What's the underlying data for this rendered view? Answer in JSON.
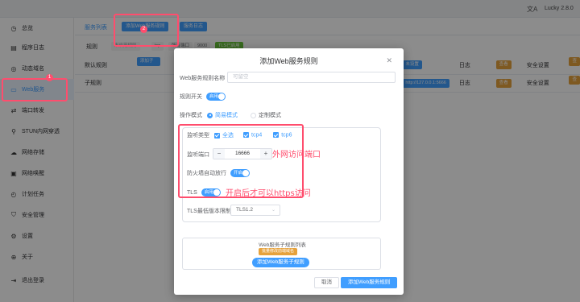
{
  "topbar": {
    "lang_icon": "文A",
    "version": "Lucky 2.8.0"
  },
  "sidebar": {
    "items": [
      {
        "label": "总览",
        "icon": "dashboard-icon"
      },
      {
        "label": "程序日志",
        "icon": "document-icon"
      },
      {
        "label": "动态域名",
        "icon": "globe-icon"
      },
      {
        "label": "Web服务",
        "icon": "web-icon"
      },
      {
        "label": "端口转发",
        "icon": "port-forward-icon"
      },
      {
        "label": "STUN内网穿透",
        "icon": "stun-icon"
      },
      {
        "label": "网络存储",
        "icon": "cloud-icon"
      },
      {
        "label": "网络唤醒",
        "icon": "wake-icon"
      },
      {
        "label": "计划任务",
        "icon": "clock-icon"
      },
      {
        "label": "安全管理",
        "icon": "shield-icon"
      },
      {
        "label": "设置",
        "icon": "gear-icon"
      },
      {
        "label": "关于",
        "icon": "info-icon"
      },
      {
        "label": "退出登录",
        "icon": "logout-icon"
      }
    ],
    "active_badge": "1"
  },
  "main": {
    "tab_label": "服务列表",
    "add_rule_btn": "添加Web服务规则",
    "log_btn": "服务日志",
    "add_badge": "2",
    "rule_label": "规则",
    "chips": [
      "未启用规则",
      "tcp",
      "所有端口",
      "9000",
      "TLS已启用"
    ],
    "bg_row1": {
      "c1": "默认规则",
      "add_child": "添加子规则",
      "status_on": "启用",
      "url": "未设置",
      "log_label": "日志",
      "view": "查看",
      "security": "安全设置",
      "view2": "查看"
    },
    "bg_row2": {
      "c1": "子规则",
      "url": "http://127.0.0.1:5666",
      "log_label": "日志",
      "view": "查看",
      "security": "安全设置",
      "view2": "查看"
    }
  },
  "dialog": {
    "title": "添加Web服务规则",
    "name_label": "Web服务规则名称",
    "name_placeholder": "可留空",
    "switch_label": "规则开关",
    "switch_value": "启用",
    "mode_label": "操作模式",
    "mode_simple": "简易模式",
    "mode_custom": "定制模式",
    "listen_type_label": "监听类型",
    "listen_all": "全选",
    "listen_tcp4": "tcp4",
    "listen_tcp6": "tcp6",
    "port_label": "监听端口",
    "port_value": "16666",
    "firewall_label": "防火墙自动放行",
    "firewall_value": "开启",
    "tls_label": "TLS",
    "tls_value": "启用",
    "tls_min_label": "TLS最低版本限制",
    "tls_min_value": "TLS1.2",
    "sub_list_title": "Web服务子规则列表",
    "batch_btn": "批量修改前端域名",
    "add_sub_btn": "添加Web服务子规则",
    "cancel": "取消",
    "confirm": "添加Web服务规则"
  },
  "annotations": {
    "port_note": "外网访问端口",
    "tls_note": "开启后才可以https访问"
  },
  "colors": {
    "accent": "#409eff",
    "annotation": "#ff4d6d",
    "sidebar_active_bg": "#ecf5ff"
  }
}
